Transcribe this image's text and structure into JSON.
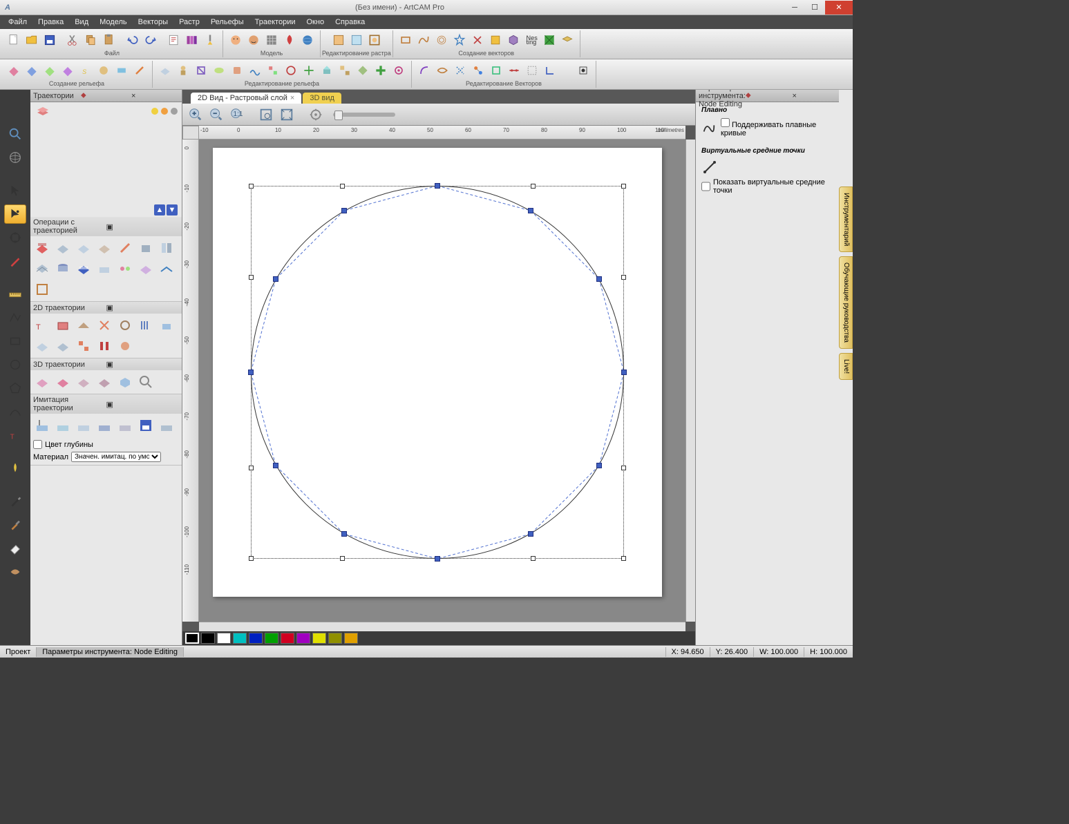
{
  "title": "(Без имени) - ArtCAM Pro",
  "menu": [
    "Файл",
    "Правка",
    "Вид",
    "Модель",
    "Векторы",
    "Растр",
    "Рельефы",
    "Траектории",
    "Окно",
    "Справка"
  ],
  "toolbar1": {
    "groups": [
      {
        "label": "Файл"
      },
      {
        "label": "Модель"
      },
      {
        "label": "Редактирование растра"
      },
      {
        "label": "Создание векторов"
      }
    ]
  },
  "toolbar2": {
    "groups": [
      {
        "label": "Создание рельефа"
      },
      {
        "label": "Редактирование рельефа"
      },
      {
        "label": "Редактирование Векторов"
      }
    ]
  },
  "panels": {
    "traj": {
      "title": "Траектории",
      "sections": {
        "ops": "Операции с траекторией",
        "d2": "2D траектории",
        "d3": "3D траектории",
        "sim": "Имитация траектории"
      },
      "depth_color": "Цвет глубины",
      "material_label": "Материал",
      "material_value": "Значен. имитац. по умолч."
    },
    "right": {
      "title": "Параметры инструмента: Node Editing",
      "sec1": "Плавно",
      "opt1": "Поддерживать плавные кривые",
      "sec2": "Виртуальные средние точки",
      "opt2": "Показать виртуальные средние точки"
    }
  },
  "tabs": {
    "t1": "2D Вид - Растровый слой",
    "t2": "3D вид"
  },
  "ruler": {
    "unit": "millimetres",
    "h": [
      "-10",
      "0",
      "10",
      "20",
      "30",
      "40",
      "50",
      "60",
      "70",
      "80",
      "90",
      "100",
      "110"
    ],
    "v": [
      "0",
      "-10",
      "-20",
      "-30",
      "-40",
      "-50",
      "-60",
      "-70",
      "-80",
      "-90",
      "-100",
      "-110"
    ]
  },
  "side_tabs": [
    "Инструментарий",
    "Обучающие руководства",
    "Live!"
  ],
  "colors": [
    "#000000",
    "#000000",
    "#ffffff",
    "#00c0c0",
    "#0020c0",
    "#00a000",
    "#d00020",
    "#a000c0",
    "#e0e000",
    "#909000",
    "#e0a000"
  ],
  "status": {
    "left": [
      "Проект",
      "Параметры инструмента: Node Editing"
    ],
    "x": "X: 94.650",
    "y": "Y: 26.400",
    "w": "W: 100.000",
    "h": "H: 100.000"
  }
}
